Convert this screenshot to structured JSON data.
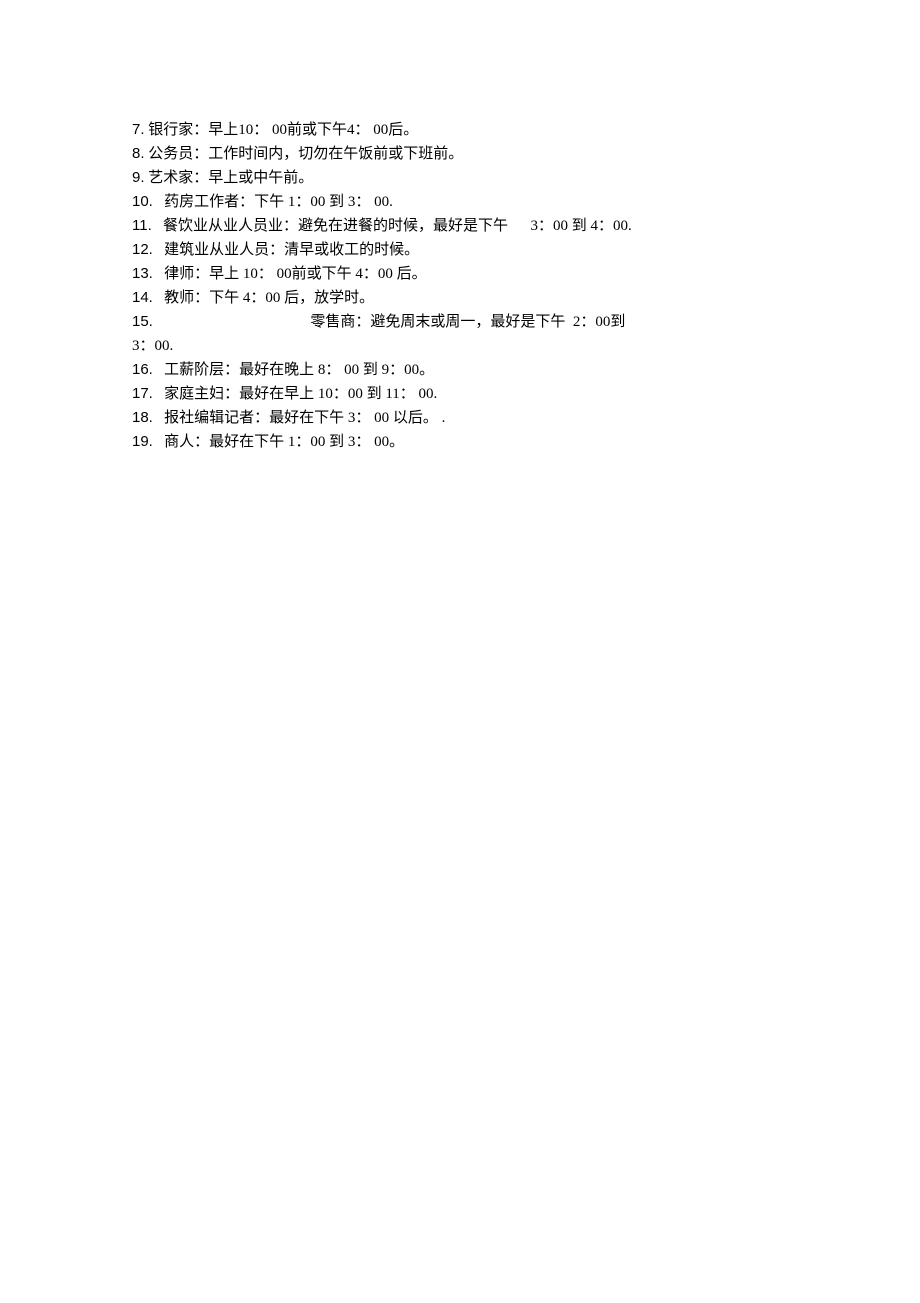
{
  "items": [
    {
      "num": "7.",
      "text": " 银行家：早上10： 00前或下午4： 00后。"
    },
    {
      "num": "8.",
      "text": " 公务员：工作时间内，切勿在午饭前或下班前。"
    },
    {
      "num": "9.",
      "text": " 艺术家：早上或中午前。"
    },
    {
      "num": "10.",
      "text": "   药房工作者：下午 1：00 到 3： 00."
    },
    {
      "num": "11.",
      "text": "   餐饮业从业人员业：避免在进餐的时候，最好是下午      3：00 到 4：00."
    },
    {
      "num": "12.",
      "text": "   建筑业从业人员：清早或收工的时候。"
    },
    {
      "num": "13.",
      "text": "   律师：早上 10： 00前或下午 4：00 后。"
    },
    {
      "num": "14.",
      "text": "   教师：下午 4：00 后，放学时。"
    },
    {
      "num": "15.",
      "text": "                                          零售商：避免周末或周一，最好是下午  2：00到"
    },
    {
      "num": "",
      "text": "3：00."
    },
    {
      "num": "16.",
      "text": "   工薪阶层：最好在晚上 8： 00 到 9：00。"
    },
    {
      "num": "17.",
      "text": "   家庭主妇：最好在早上 10：00 到 11： 00."
    },
    {
      "num": "18.",
      "text": "   报社编辑记者：最好在下午 3： 00 以后。 ."
    },
    {
      "num": "19.",
      "text": "   商人：最好在下午 1：00 到 3： 00。"
    }
  ]
}
